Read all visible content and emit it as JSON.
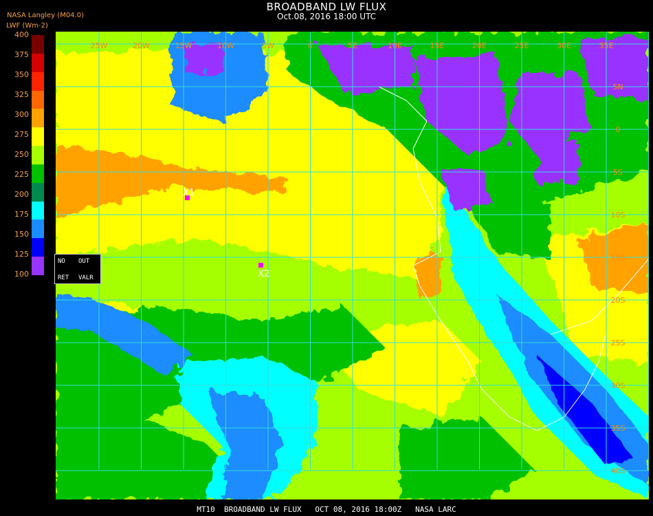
{
  "title": "BROADBAND LW FLUX",
  "subtitle": "Oct.08, 2016 18:00 UTC",
  "provider": "NASA Langley (M04.0)",
  "units_label": "LWF (Wm-2)",
  "legend": {
    "ticks": [
      "400",
      "375",
      "350",
      "325",
      "300",
      "275",
      "250",
      "225",
      "200",
      "175",
      "150",
      "125",
      "100"
    ],
    "colors": [
      "#7a0000",
      "#d40000",
      "#ff2200",
      "#ff6600",
      "#ffa200",
      "#ffff00",
      "#a6ff00",
      "#00c000",
      "#008a50",
      "#00ffff",
      "#1a8cff",
      "#0000ff",
      "#9933ff"
    ]
  },
  "lon_labels": [
    "25W",
    "20W",
    "15W",
    "10W",
    "5W",
    "0",
    "5E",
    "10E",
    "15E",
    "20E",
    "25E",
    "30E",
    "35E"
  ],
  "lat_labels": [
    "5N",
    "0",
    "5S",
    "10S",
    "15S",
    "20S",
    "25S",
    "30S",
    "35S",
    "40S"
  ],
  "markers": [
    {
      "label": "X1",
      "color": "#ff00ff"
    },
    {
      "label": "X2",
      "color": "#ff00ff"
    }
  ],
  "controls": {
    "no": "NO",
    "out": "OUT",
    "ret": "RET",
    "valr": "VALR"
  },
  "footer": "MT10  BROADBAND LW FLUX   OCT 08, 2016 18:00Z   NASA LARC"
}
